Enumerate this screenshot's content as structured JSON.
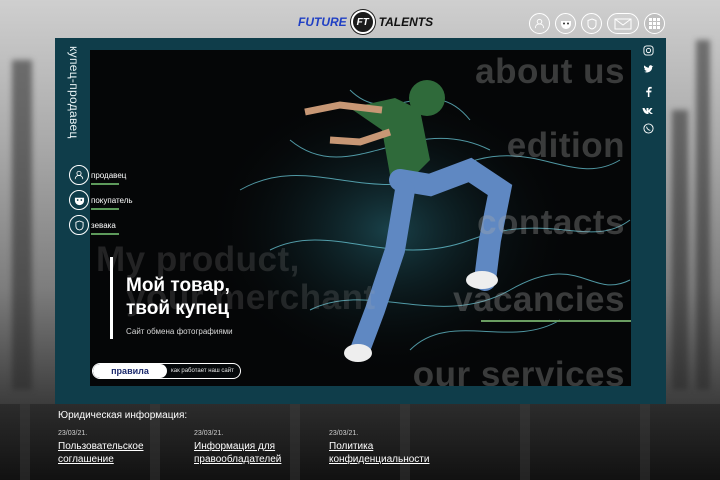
{
  "brand": {
    "part1": "FUTURE",
    "mark": "FT",
    "part2": "TALENTS"
  },
  "top_icons": [
    "user-icon",
    "mask-icon",
    "shield-icon",
    "mail-icon",
    "grid-icon"
  ],
  "sidebar": {
    "title": "купец-продавец",
    "roles": [
      {
        "label": "продавец",
        "icon": "seller-icon"
      },
      {
        "label": "покупатель",
        "icon": "buyer-icon"
      },
      {
        "label": "зевака",
        "icon": "watcher-icon"
      }
    ]
  },
  "social": [
    "instagram-icon",
    "twitter-icon",
    "facebook-icon",
    "vk-icon",
    "viber-icon"
  ],
  "menu": {
    "about": "about us",
    "edition": "edition",
    "contacts": "contacts",
    "vacancies": "vacancies",
    "services": "our services",
    "bg_line1": "My product,",
    "bg_line2": "your merchant"
  },
  "hero": {
    "title_line1": "Мой товар,",
    "title_line2": "твой купец",
    "subtitle": "Сайт обмена фотографиями",
    "cta_primary": "правила",
    "cta_secondary": "как работает наш сайт"
  },
  "legal": {
    "title": "Юридическая информация:",
    "items": [
      {
        "date": "23/03/21.",
        "line1": "Пользовательское",
        "line2": "соглашение"
      },
      {
        "date": "23/03/21.",
        "line1": "Информация для",
        "line2": "правообладателей"
      },
      {
        "date": "23/03/21.",
        "line1": "Политика",
        "line2": "конфиденциальности"
      }
    ]
  },
  "colors": {
    "panel": "#0f3d4a",
    "accent_green": "#6a9d61",
    "brand_blue": "#1f3fc4"
  }
}
